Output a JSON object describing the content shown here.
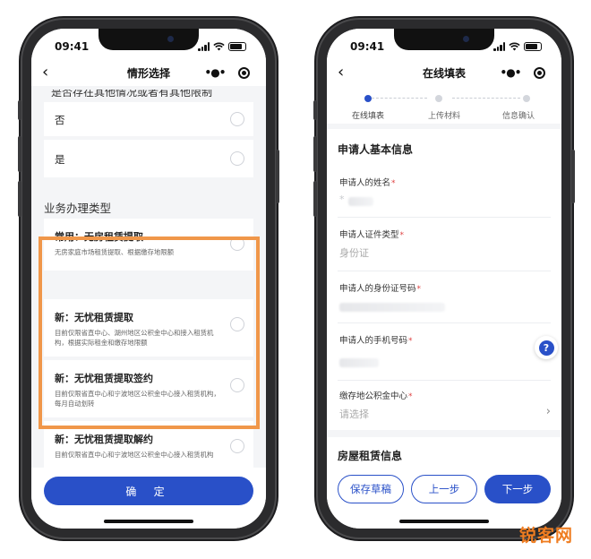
{
  "status": {
    "time": "09:41"
  },
  "left_screen": {
    "nav_title": "情形选择",
    "cut_question": "是否存在其他情况或者有其他限制条件",
    "options": [
      {
        "label": "否"
      },
      {
        "label": "是"
      }
    ],
    "section_title": "业务办理类型",
    "types": [
      {
        "name": "常用：无房租赁提取",
        "desc": "无房家庭市场租赁提取、根据缴存地限额"
      },
      {
        "name": "新：无忧租赁提取",
        "desc": "目前仅限省直中心、湖州地区公积金中心和接入租赁机构，根据实际租金和缴存地限额"
      },
      {
        "name": "新：无忧租赁提取签约",
        "desc": "目前仅限省直中心和宁波地区公积金中心接入租赁机构，每月自动划转"
      },
      {
        "name": "新：无忧租赁提取解约",
        "desc": "目前仅限省直中心和宁波地区公积金中心接入租赁机构"
      }
    ],
    "confirm_label": "确 定"
  },
  "right_screen": {
    "nav_title": "在线填表",
    "steps": [
      {
        "label": "在线填表"
      },
      {
        "label": "上传材料"
      },
      {
        "label": "信息确认"
      }
    ],
    "section1_title": "申请人基本信息",
    "fields": [
      {
        "label": "申请人的姓名",
        "value": "*"
      },
      {
        "label": "申请人证件类型",
        "value": "身份证"
      },
      {
        "label": "申请人的身份证号码",
        "value": ""
      },
      {
        "label": "申请人的手机号码",
        "value": ""
      },
      {
        "label": "缴存地公积金中心",
        "value": "请选择"
      }
    ],
    "required_mark": "*",
    "section2_title": "房屋租赁信息",
    "buttons": {
      "save_draft": "保存草稿",
      "prev": "上一步",
      "next": "下一步"
    },
    "help_glyph": "?"
  },
  "watermark": "锐客网",
  "colors": {
    "primary": "#2950c8",
    "highlight": "#f0974a",
    "required": "#e04545",
    "watermark": "#ef7d21"
  },
  "icons": [
    "back-arrow-icon",
    "more-icon",
    "record-icon",
    "chevron-right-icon",
    "help-icon",
    "signal-icon",
    "wifi-icon",
    "battery-icon"
  ]
}
